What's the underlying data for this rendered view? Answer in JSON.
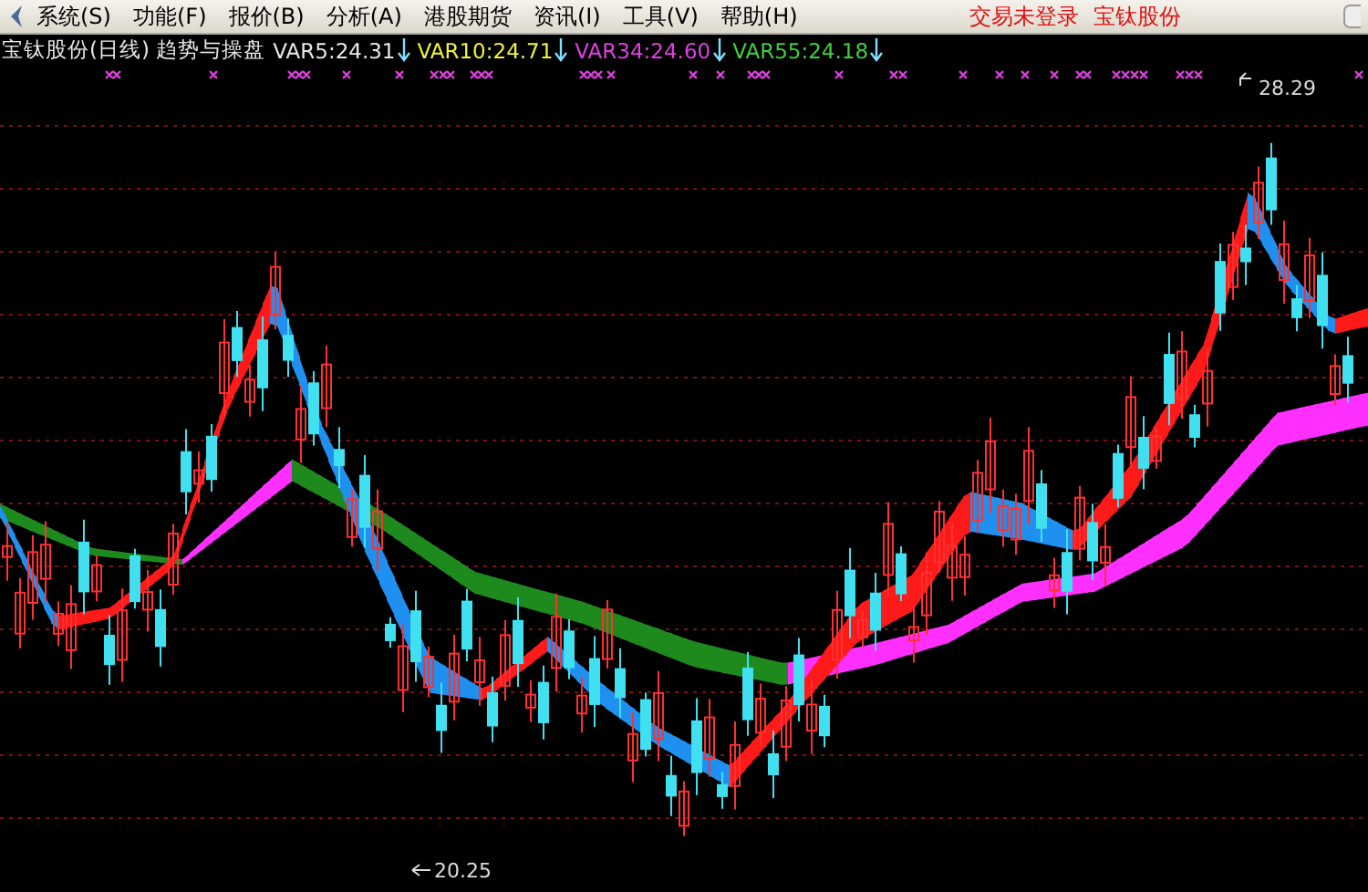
{
  "menu": {
    "items": [
      "系统(S)",
      "功能(F)",
      "报价(B)",
      "分析(A)",
      "港股期货",
      "资讯(I)",
      "工具(V)",
      "帮助(H)"
    ],
    "status": "交易未登录",
    "stock": "宝钛股份"
  },
  "legend": {
    "title": "宝钛股份(日线) 趋势与操盘",
    "indicators": [
      {
        "label": "VAR5:24.31",
        "color": "#e8e8e8"
      },
      {
        "label": "VAR10:24.71",
        "color": "#f0f040"
      },
      {
        "label": "VAR34:24.60",
        "color": "#e040e0"
      },
      {
        "label": "VAR55:24.18",
        "color": "#40d040"
      }
    ]
  },
  "chart": {
    "high_label": "28.29",
    "low_label": "20.25"
  }
}
